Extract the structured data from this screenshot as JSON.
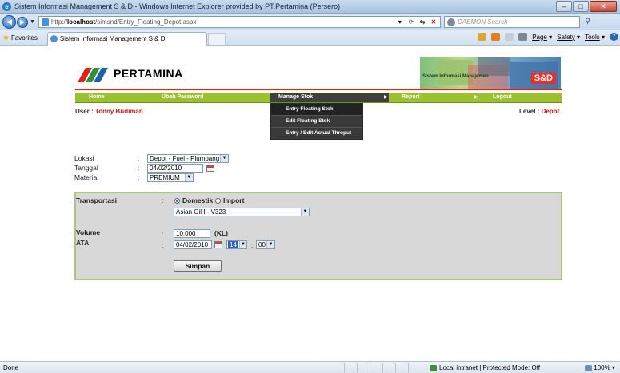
{
  "window": {
    "title": "Sistem Informasi Management S & D - Windows Internet Explorer provided by PT.Pertamina (Persero)",
    "minimize": "–",
    "maximize": "□",
    "close": "✕"
  },
  "address_bar": {
    "url_prefix": "http://",
    "url_host": "localhost",
    "url_path": "/simsnd/Entry_Floating_Depot.aspx",
    "search_placeholder": "DAEMON Search"
  },
  "favorites_bar": {
    "favorites_label": "Favorites",
    "tab_title": "Sistem Informasi Management S & D",
    "page_menu": "Page",
    "safety_menu": "Safety",
    "tools_menu": "Tools"
  },
  "header": {
    "logo_text": "PERTAMINA",
    "banner_caption": "Sistem Informasi Manajemen",
    "banner_tag": "S&D"
  },
  "menu": {
    "items": [
      "Home",
      "Ubah Password",
      "Manage Stok",
      "Report",
      "Logout"
    ],
    "dropdown": [
      "Entry Floating Stok",
      "Edit Floating Stok",
      "Entry / Edit Actual Throput"
    ]
  },
  "user": {
    "user_label": "User : ",
    "user_name": "Tonny Budiman",
    "level_label": "Level : ",
    "level_value": "Depot"
  },
  "form": {
    "lokasi_label": "Lokasi",
    "lokasi_value": "Depot - Fuel - Plumpang",
    "tanggal_label": "Tanggal",
    "tanggal_value": "04/02/2010",
    "material_label": "Material",
    "material_value": "PREMIUM",
    "colon": ":"
  },
  "panel": {
    "transportasi_label": "Transportasi",
    "option_domestik": "Domestik",
    "option_import": "Import",
    "vessel_value": "Asian Oil I - V323",
    "volume_label": "Volume",
    "volume_value": "10,000",
    "volume_unit": "(KL)",
    "ata_label": "ATA",
    "ata_date": "04/02/2010",
    "ata_hour": "14",
    "ata_minute": "00",
    "time_separator": ":",
    "save_button": "Simpan"
  },
  "status_bar": {
    "status": "Done",
    "zone": "Local intranet | Protected Mode: Off",
    "zoom": "100%"
  }
}
